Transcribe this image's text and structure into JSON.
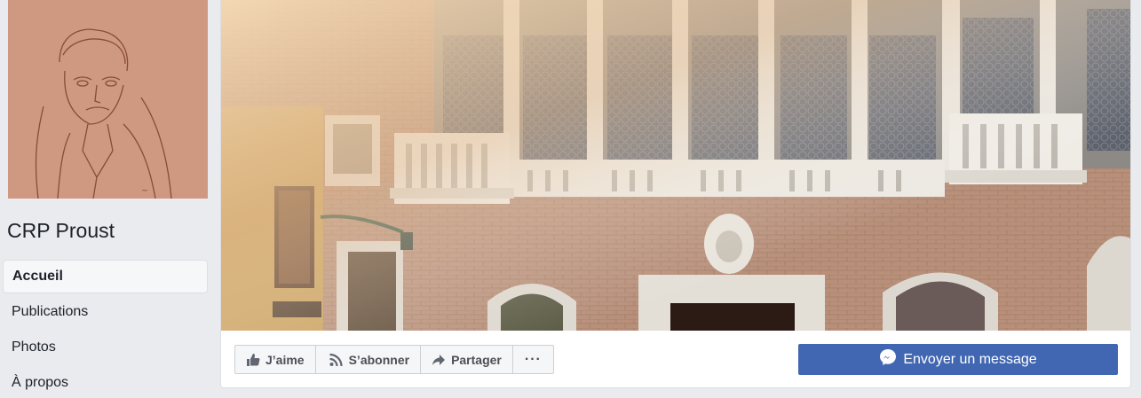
{
  "page": {
    "name": "CRP Proust"
  },
  "nav": {
    "items": [
      {
        "label": "Accueil",
        "active": true
      },
      {
        "label": "Publications",
        "active": false
      },
      {
        "label": "Photos",
        "active": false
      },
      {
        "label": "À propos",
        "active": false
      }
    ]
  },
  "actions": {
    "like_label": "J’aime",
    "follow_label": "S’abonner",
    "share_label": "Partager",
    "more_label": "···",
    "message_label": "Envoyer un message"
  },
  "colors": {
    "brand_blue": "#4267b2",
    "page_bg": "#e9ebee",
    "sketch_tone": "#c98f78"
  },
  "icons": {
    "like": "thumbs-up-icon",
    "follow": "rss-icon",
    "share": "share-arrow-icon",
    "more": "more-dots-icon",
    "messenger": "messenger-icon"
  }
}
